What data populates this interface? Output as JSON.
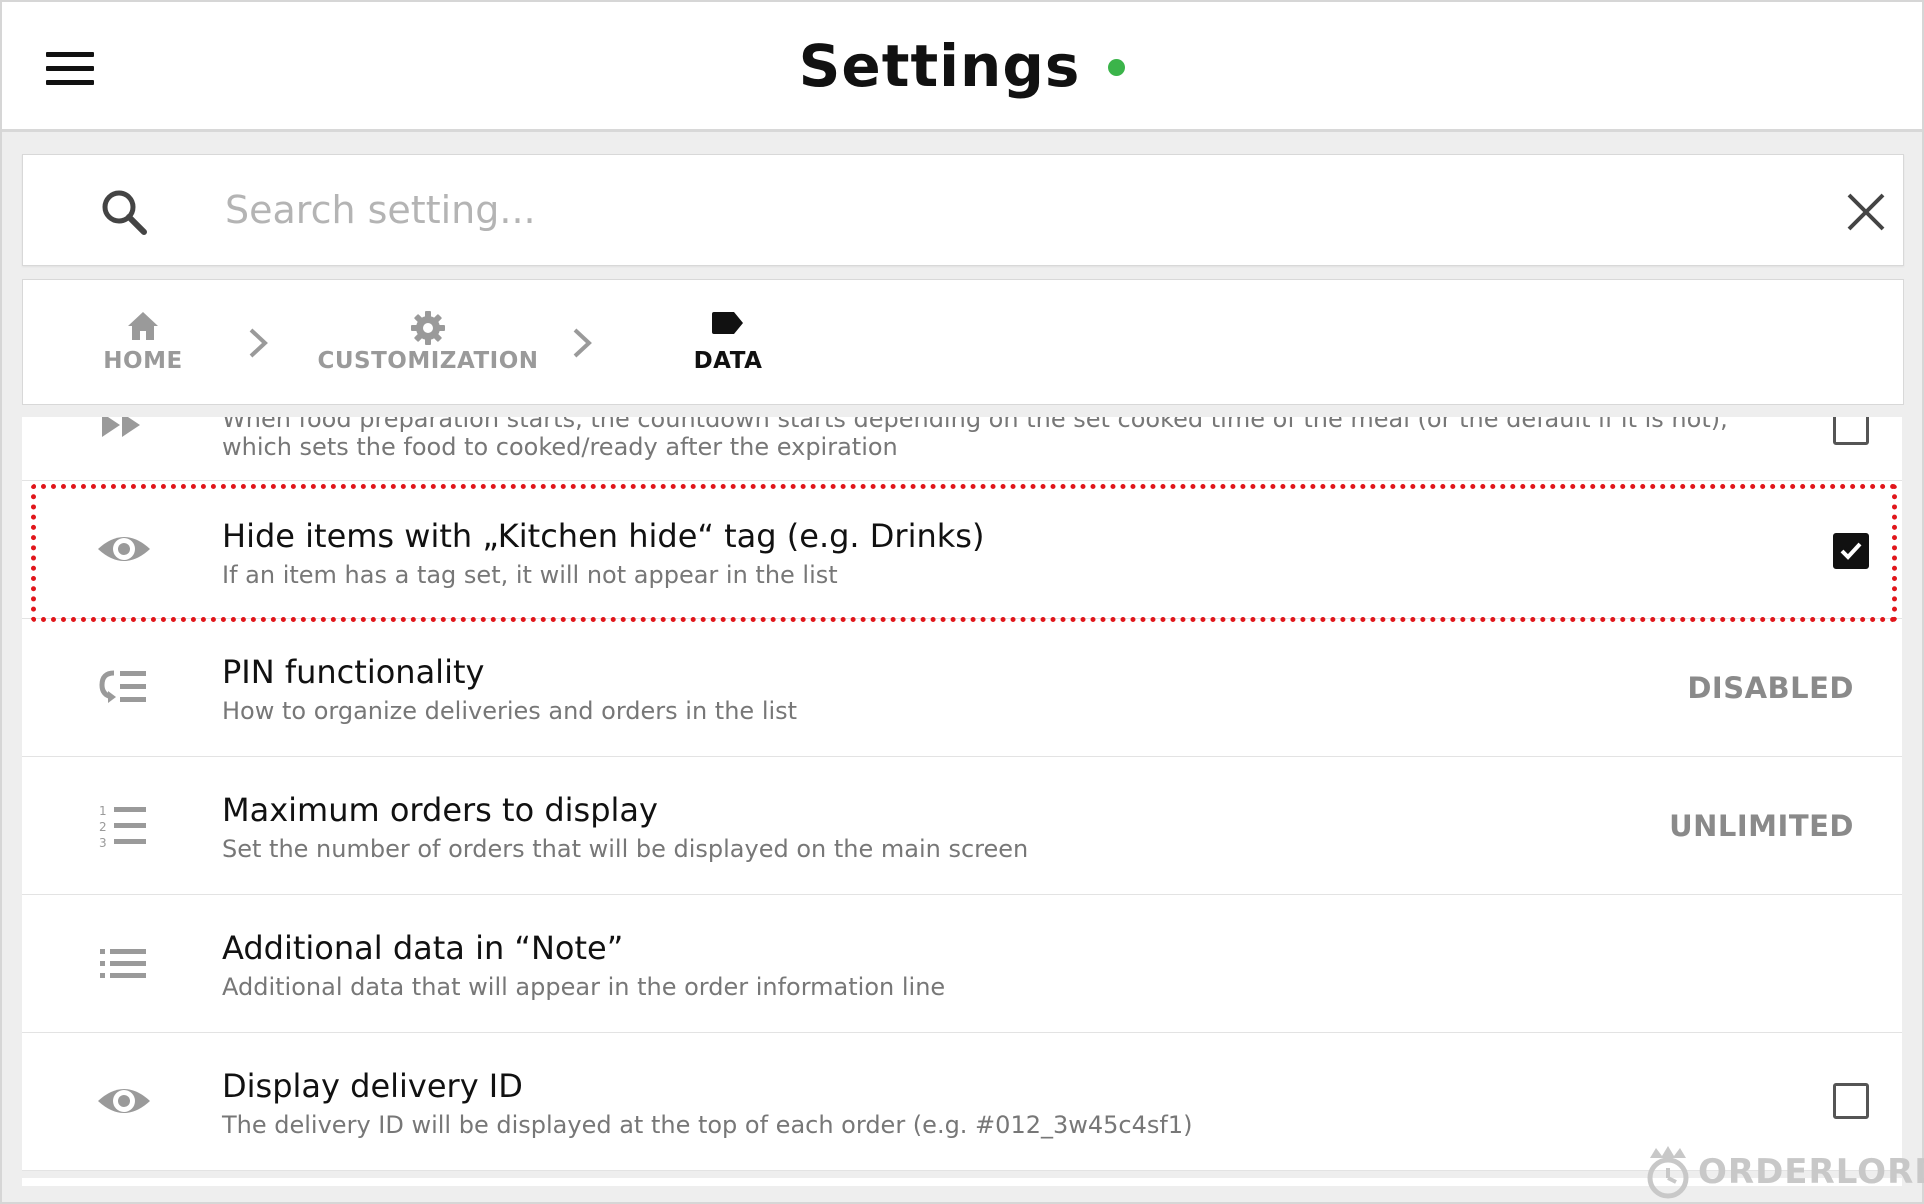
{
  "header": {
    "title": "Settings",
    "status_color": "#3bb44a",
    "menu_icon": "hamburger-menu-icon"
  },
  "search": {
    "placeholder": "Search setting...",
    "value": "",
    "icon": "search-icon",
    "clear_icon": "close-icon"
  },
  "breadcrumb": [
    {
      "label": "HOME",
      "icon": "home-icon"
    },
    {
      "label": "CUSTOMIZATION",
      "icon": "gear-icon"
    },
    {
      "label": "DATA",
      "icon": "tag-icon",
      "active": true
    }
  ],
  "settings": [
    {
      "icon": "fast-forward-icon",
      "title": "",
      "desc_line1": "When food preparation starts, the countdown starts depending on the set cooked time of the meal (or the default if it is not),",
      "desc_line2": "which sets the food to cooked/ready after the expiration",
      "control": "checkbox",
      "checked": false
    },
    {
      "icon": "eye-icon",
      "title": "Hide items with „Kitchen hide“ tag (e.g. Drinks)",
      "desc": "If an item has a tag set, it will not appear in the list",
      "control": "checkbox",
      "checked": true,
      "highlighted": true
    },
    {
      "icon": "sort-list-icon",
      "title": "PIN functionality",
      "desc": "How to organize deliveries and orders in the list",
      "control": "value",
      "value": "DISABLED"
    },
    {
      "icon": "numbered-list-icon",
      "title": "Maximum orders to display",
      "desc": "Set the number of orders that will be displayed on the main screen",
      "control": "value",
      "value": "UNLIMITED"
    },
    {
      "icon": "bulleted-list-icon",
      "title": "Additional data in “Note”",
      "desc": "Additional data that will appear in the order information line",
      "control": "none"
    },
    {
      "icon": "eye-icon",
      "title": "Display delivery ID",
      "desc": "The delivery ID will be displayed at the top of each order (e.g. #012_3w45c4sf1)",
      "control": "checkbox",
      "checked": false
    }
  ],
  "highlight_color": "#e0161b",
  "logo": {
    "text": "ORDERLORD",
    "icon": "crown-clock-icon"
  }
}
